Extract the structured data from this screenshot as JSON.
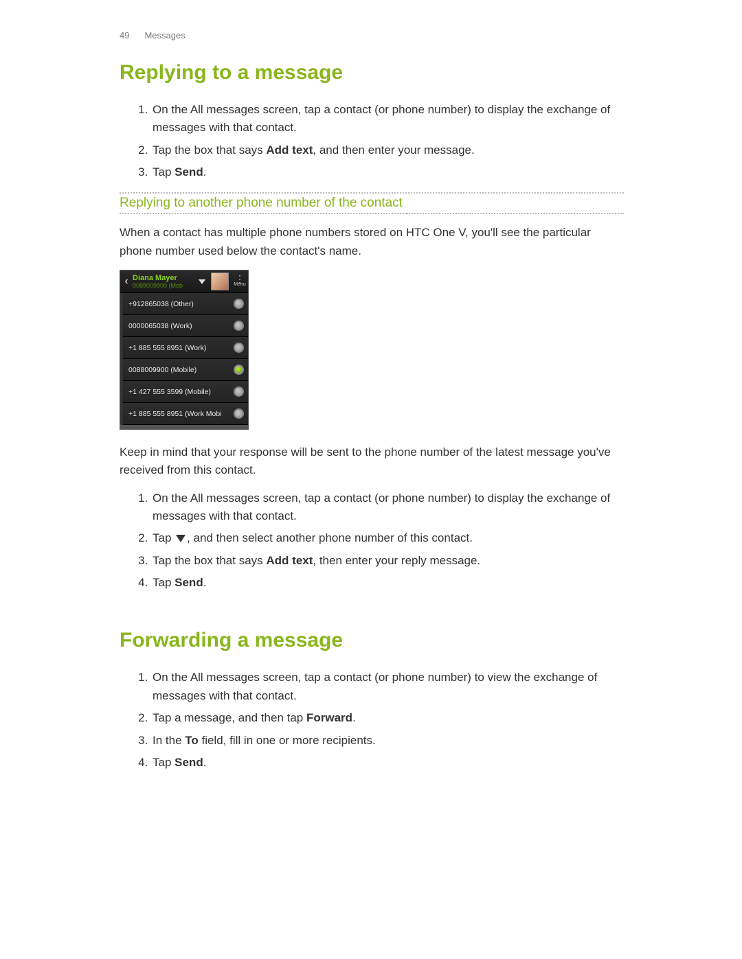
{
  "header": {
    "page": "49",
    "section": "Messages"
  },
  "replying": {
    "title": "Replying to a message",
    "steps": [
      {
        "pre": "On the All messages screen, tap a contact (or phone number) to display the exchange of messages with that contact."
      },
      {
        "pre": "Tap the box that says ",
        "bold": "Add text",
        "post": ", and then enter your message."
      },
      {
        "pre": "Tap ",
        "bold": "Send",
        "post": "."
      }
    ],
    "subhead": "Replying to another phone number of the contact",
    "para1": "When a contact has multiple phone numbers stored on HTC One V, you'll see the particular phone number used below the contact's name.",
    "para2": "Keep in mind that your response will be sent to the phone number of the latest message you've received from this contact.",
    "steps2": [
      {
        "pre": "On the All messages screen, tap a contact (or phone number) to display the exchange of messages with that contact."
      },
      {
        "pre": "Tap ",
        "icon": "triangle-down",
        "post": ", and then select another phone number of this contact."
      },
      {
        "pre": "Tap the box that says ",
        "bold": "Add text",
        "post": ", then enter your reply message."
      },
      {
        "pre": "Tap ",
        "bold": "Send",
        "post": "."
      }
    ]
  },
  "forwarding": {
    "title": "Forwarding a message",
    "steps": [
      {
        "pre": "On the All messages screen, tap a contact (or phone number) to view the exchange of messages with that contact."
      },
      {
        "pre": "Tap a message, and then tap ",
        "bold": "Forward",
        "post": "."
      },
      {
        "pre": "In the ",
        "bold": "To",
        "post": " field, fill in one or more recipients."
      },
      {
        "pre": "Tap ",
        "bold": "Send",
        "post": "."
      }
    ]
  },
  "phone": {
    "contact_name": "Diana Mayer",
    "contact_sub": "0088009900 (Mob",
    "menu_label": "Menu",
    "numbers": [
      {
        "text": "+912865038 (Other)",
        "selected": false
      },
      {
        "text": "0000065038 (Work)",
        "selected": false
      },
      {
        "text": "+1 885 555 8951 (Work)",
        "selected": false
      },
      {
        "text": "0088009900 (Mobile)",
        "selected": true
      },
      {
        "text": "+1 427 555 3599 (Mobile)",
        "selected": false
      },
      {
        "text": "+1 885 555 8951 (Work Mobi",
        "selected": false
      }
    ]
  }
}
